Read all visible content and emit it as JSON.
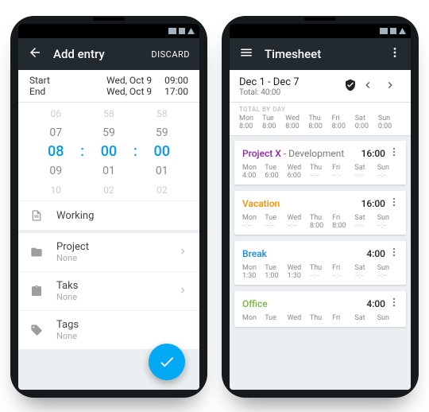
{
  "left": {
    "title": "Add entry",
    "discard": "DISCARD",
    "start_label": "Start",
    "end_label": "End",
    "start_date": "Wed, Oct 9",
    "start_time": "09:00",
    "end_date": "Wed, Oct 9",
    "end_time": "17:00",
    "picker": {
      "h": [
        "06",
        "07",
        "08",
        "09",
        "10"
      ],
      "m": [
        "58",
        "59",
        "00",
        "01",
        "02"
      ],
      "s": [
        "58",
        "59",
        "00",
        "01",
        "02"
      ]
    },
    "rows": {
      "working": "Working",
      "project_label": "Project",
      "project_value": "None",
      "task_label": "Taks",
      "task_value": "None",
      "tags_label": "Tags",
      "tags_value": "None"
    }
  },
  "right": {
    "title": "Timesheet",
    "range": "Dec 1 - Dec 7",
    "total": "Total: 40:00",
    "day_header_label": "TOTAL BY DAY",
    "day_names": [
      "Mon",
      "Tue",
      "Wed",
      "Thu",
      "Fri",
      "Sat",
      "Sun"
    ],
    "day_totals": [
      "8:00",
      "8:00",
      "8:00",
      "8:00",
      "8:00",
      "0:00",
      "0:00"
    ],
    "projects": [
      {
        "name": "Project X",
        "suffix": " - Development",
        "color": "c-purple",
        "total": "16:00",
        "values": [
          "4:00",
          "6:00",
          "6:00",
          "--:--",
          "--:--",
          "--:--",
          "--:--"
        ]
      },
      {
        "name": "Vacation",
        "suffix": "",
        "color": "c-orange",
        "total": "16:00",
        "values": [
          "--:--",
          "--:--",
          "--:--",
          "8:00",
          "8:00",
          "--:--",
          "--:--"
        ]
      },
      {
        "name": "Break",
        "suffix": "",
        "color": "c-blue",
        "total": "4:00",
        "values": [
          "1:30",
          "1:00",
          "1:30",
          "--:--",
          "--:--",
          "--:--",
          "--:--"
        ]
      },
      {
        "name": "Office",
        "suffix": "",
        "color": "c-green",
        "total": "4:00",
        "values": [
          "",
          "",
          "",
          "",
          "",
          "",
          ""
        ]
      }
    ]
  }
}
